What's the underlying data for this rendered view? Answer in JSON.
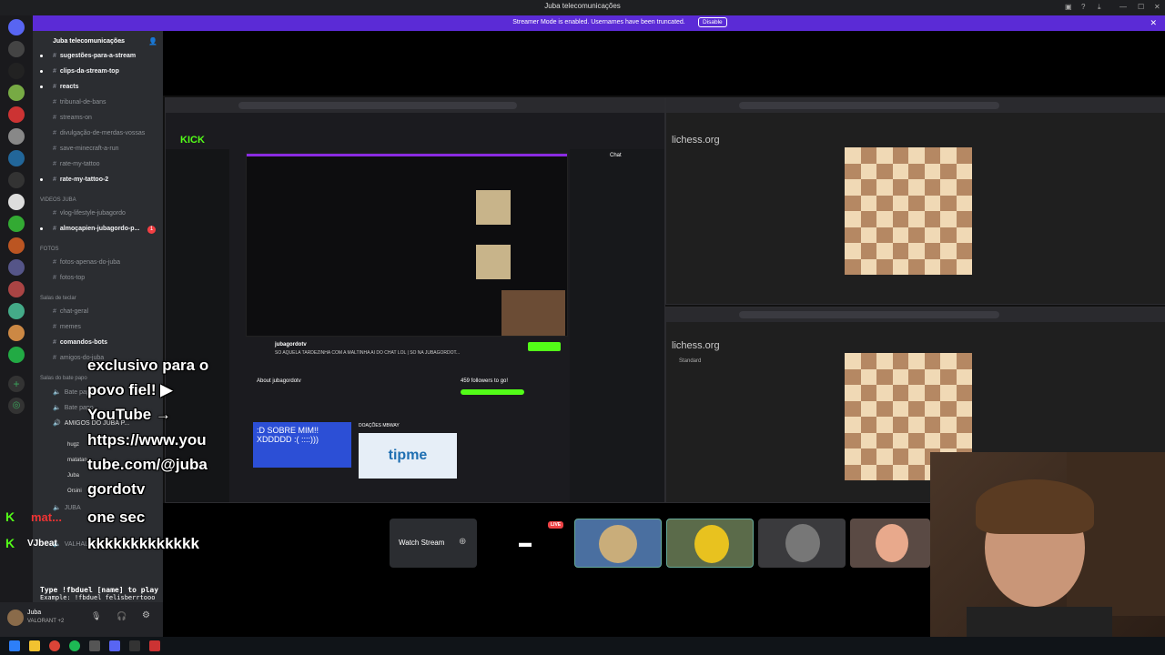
{
  "window": {
    "title": "Juba telecomunicações"
  },
  "banner": {
    "text": "Streamer Mode is enabled. Usernames have been truncated.",
    "disable_label": "Disable"
  },
  "server": {
    "name": "Juba telecomunicações"
  },
  "channels": [
    {
      "name": "sugestões-para-a-stream",
      "unread": true
    },
    {
      "name": "clips-da-stream-top",
      "unread": true
    },
    {
      "name": "reacts",
      "unread": true
    },
    {
      "name": "tribunal-de-bans",
      "unread": false
    },
    {
      "name": "streams-on",
      "unread": false
    },
    {
      "name": "divulgação-de-merdas-vossas",
      "unread": false
    },
    {
      "name": "save-minecraft-a-run",
      "unread": false
    },
    {
      "name": "rate-my-tattoo",
      "unread": false
    },
    {
      "name": "rate-my-tattoo-2",
      "unread": true
    }
  ],
  "category_videos": "VIDEOS JUBA",
  "channels_videos": [
    {
      "name": "vlog-lifestyle-jubagordo",
      "unread": false
    },
    {
      "name": "almoçapien-jubagordo-p...",
      "unread": true,
      "badge": "1"
    }
  ],
  "category_fotos": "FOTOS",
  "channels_fotos": [
    {
      "name": "fotos-apenas-do-juba"
    },
    {
      "name": "fotos-top"
    }
  ],
  "category_salas": "Salas de teclar",
  "channels_salas": [
    {
      "name": "chat-geral"
    },
    {
      "name": "memes"
    },
    {
      "name": "comandos-bots"
    },
    {
      "name": "amigos-do-juba"
    }
  ],
  "category_voice": "Salas do bate papo",
  "voice_channels": [
    "Bate papo",
    "Bate papo",
    "AMIGOS DO JUBA P..."
  ],
  "voice_users": [
    "hugz",
    "matatan",
    "Juba",
    "Orsini"
  ],
  "voice_extra": [
    "JUBA",
    "VALHALLA"
  ],
  "user": {
    "name": "Juba",
    "status": "VALORANT +2"
  },
  "overlay_chat": {
    "lines": [
      "exclusivo para o",
      "povo fiel! ▶",
      "YouTube →",
      "https://www.you",
      "tube.com/@juba",
      "gordotv",
      "one sec",
      "kkkkkkkkkkkkk"
    ],
    "users": [
      "mat...",
      "VJbeat"
    ],
    "command_hint": "Type !fbduel [name] to play",
    "command_example": "Example: !fbduel felisberrtooo"
  },
  "stream": {
    "left_window": {
      "site": "KICK",
      "channel": "jubagordotv",
      "title": "SÓ AQUELA TARDEZINHA COM A MALTINHA AI DO CHAT LOL | SÓ NA JUBAGORDOT...",
      "followers_label": "459 followers to go!",
      "about": "About jubagordotv",
      "panel_text": ":D SOBRE MIM!! XDDDDD :( ::::)))",
      "donations_label": "DOAÇÕES MBWAY",
      "tipme_label": "tipme",
      "chat_header": "Chat"
    },
    "right_top": {
      "site": "lichess.org"
    },
    "right_bottom": {
      "site": "lichess.org",
      "mode": "Standard"
    }
  },
  "participants": {
    "watch_stream_label": "Watch Stream",
    "live_badge": "LIVE"
  },
  "colors": {
    "banner": "#5b2bd6",
    "kick_green": "#53fc18",
    "board_light": "#f0d9b5",
    "board_dark": "#b58863",
    "highlight": "#cdd26a"
  }
}
